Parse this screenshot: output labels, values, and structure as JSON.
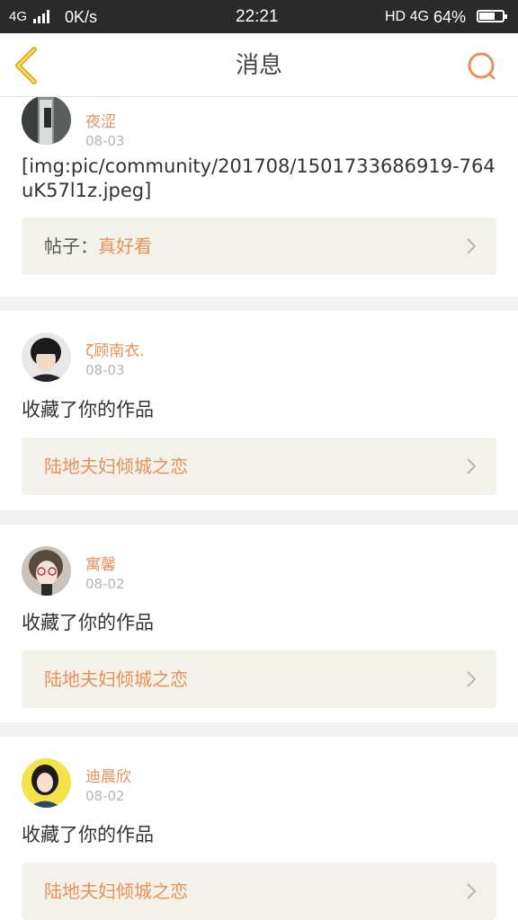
{
  "status_bar": {
    "network": "4G",
    "speed": "0K/s",
    "time": "22:21",
    "hd": "HD",
    "network2": "4G",
    "battery": "64%",
    "battery_level": 0.64
  },
  "header": {
    "title": "消息",
    "back_icon": "chevron-left-icon",
    "search_icon": "search-icon"
  },
  "colors": {
    "accent": "#e8915a",
    "back_arrow": "#e0b020",
    "link_bg": "#f3f2ea",
    "page_bg": "#f2f2f2"
  },
  "messages": [
    {
      "user": "夜涩",
      "date": "08-03",
      "content": "[img:pic/community/201708/1501733686919-764uK57l1z.jpeg]",
      "link_prefix": "帖子：",
      "link_title": "真好看"
    },
    {
      "user": "ζ顾南衣.",
      "date": "08-03",
      "content": "收藏了你的作品",
      "link_prefix": "",
      "link_title": "陆地夫妇倾城之恋"
    },
    {
      "user": "寓馨",
      "date": "08-02",
      "content": "收藏了你的作品",
      "link_prefix": "",
      "link_title": "陆地夫妇倾城之恋"
    },
    {
      "user": "迪晨欣",
      "date": "08-02",
      "content": "收藏了你的作品",
      "link_prefix": "",
      "link_title": "陆地夫妇倾城之恋"
    }
  ]
}
